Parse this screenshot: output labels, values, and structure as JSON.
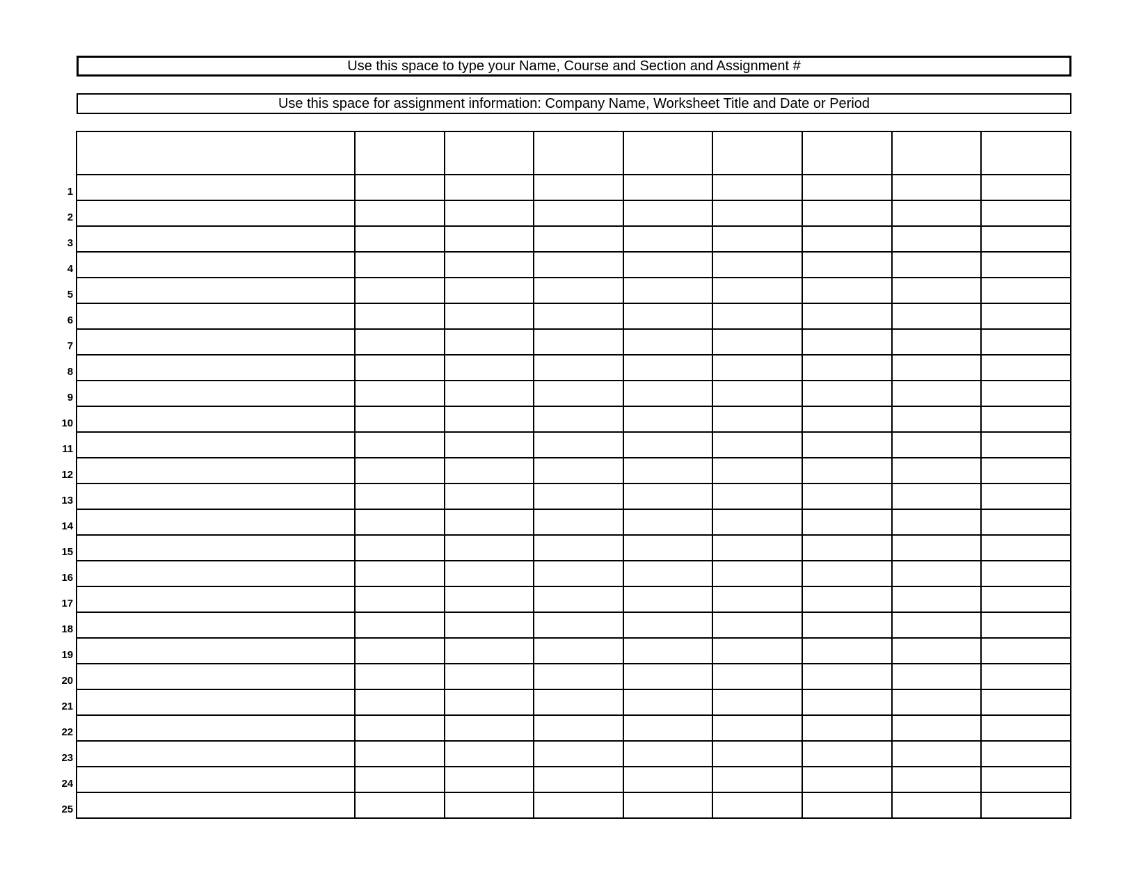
{
  "header1": "Use this space to type your Name, Course and Section and Assignment #",
  "header2": "Use this space for assignment information: Company Name, Worksheet Title and Date or Period",
  "row_count": 25,
  "data_columns": 9,
  "row_labels": [
    "1",
    "2",
    "3",
    "4",
    "5",
    "6",
    "7",
    "8",
    "9",
    "10",
    "11",
    "12",
    "13",
    "14",
    "15",
    "16",
    "17",
    "18",
    "19",
    "20",
    "21",
    "22",
    "23",
    "24",
    "25"
  ]
}
